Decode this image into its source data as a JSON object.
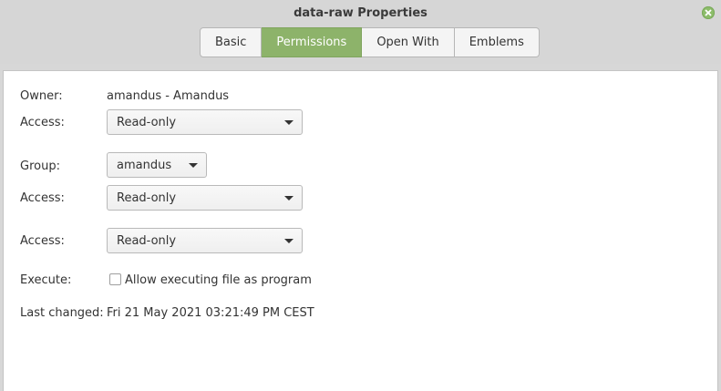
{
  "window": {
    "title": "data-raw Properties"
  },
  "tabs": [
    {
      "label": "Basic"
    },
    {
      "label": "Permissions"
    },
    {
      "label": "Open With"
    },
    {
      "label": "Emblems"
    }
  ],
  "permissions": {
    "owner_label": "Owner:",
    "owner_value": "amandus - Amandus",
    "owner_access_label": "Access:",
    "owner_access_value": "Read-only",
    "group_label": "Group:",
    "group_value": "amandus",
    "group_access_label": "Access:",
    "group_access_value": "Read-only",
    "others_access_label": "Access:",
    "others_access_value": "Read-only",
    "execute_label": "Execute:",
    "execute_checkbox_label": "Allow executing file as program",
    "last_changed_label": "Last changed:",
    "last_changed_value": "Fri 21 May 2021 03:21:49 PM CEST"
  },
  "colors": {
    "accent": "#8db36a",
    "close_button": "#8cbd6a"
  },
  "icons": {
    "close": "close-icon",
    "dropdown": "chevron-down-icon"
  }
}
